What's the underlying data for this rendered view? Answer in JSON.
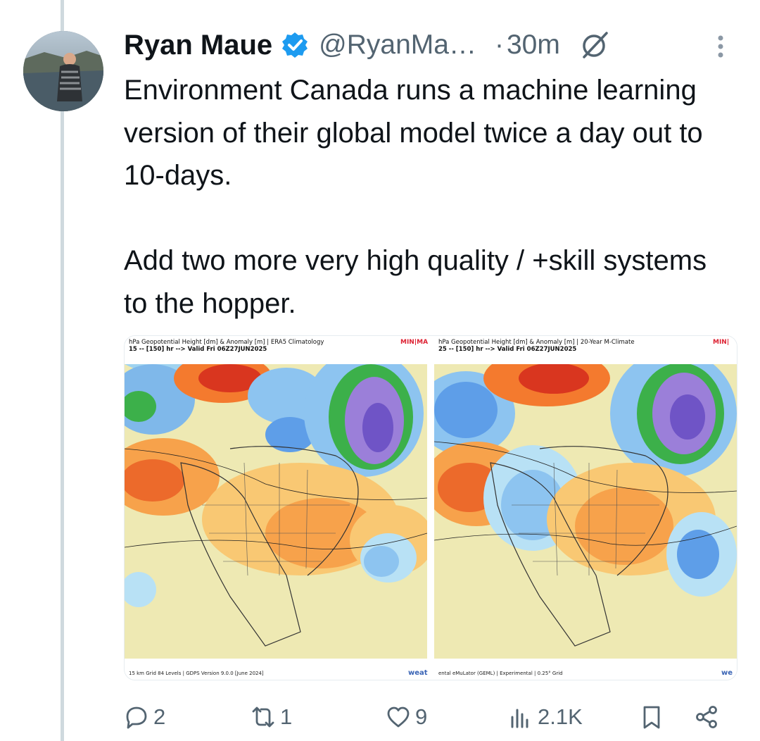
{
  "tweet": {
    "author_name": "Ryan Maue",
    "handle": "@RyanMa…",
    "separator": "·",
    "time": "30m",
    "text": "Environment Canada runs a machine learning version of their global model twice a day out to 10-days.\n\nAdd two more very high quality / +skill systems to the hopper."
  },
  "media": {
    "left_map": {
      "title_line1": "hPa Geopotential Height [dm] & Anomaly [m] | ERA5 Climatology",
      "title_line2": "15 -- [150] hr --> Valid Fri 06Z27JUN2025",
      "brand": "MIN|MA",
      "footer": "15 km Grid 84 Levels | GDPS Version 9.0.0 [June 2024]",
      "credit": "weat"
    },
    "right_map": {
      "title_line1": "hPa Geopotential Height [dm] & Anomaly [m] | 20-Year M-Climate",
      "title_line2": "25 -- [150] hr --> Valid Fri 06Z27JUN2025",
      "brand": "MIN|",
      "footer": "ental eMuLator (GEML) | Experimental | 0.25° Grid",
      "credit": "we"
    }
  },
  "actions": {
    "replies": "2",
    "reposts": "1",
    "likes": "9",
    "views": "2.1K"
  },
  "colors": {
    "text": "#0f1419",
    "secondary": "#536471",
    "verified": "#1d9bf0",
    "thread_line": "#cfd9de"
  },
  "icons": [
    "verified-badge-icon",
    "grok-icon",
    "more-icon",
    "reply-icon",
    "repost-icon",
    "like-icon",
    "views-icon",
    "bookmark-icon",
    "share-icon"
  ]
}
